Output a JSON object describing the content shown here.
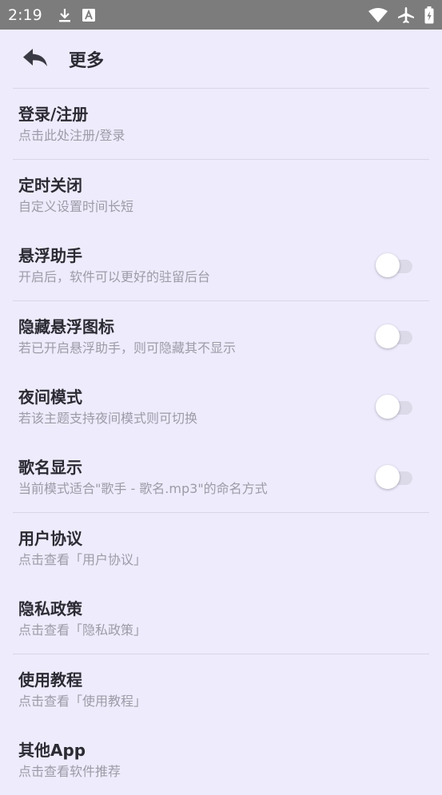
{
  "status_bar": {
    "time": "2:19",
    "icons": [
      "download-icon",
      "a-badge-icon",
      "wifi-icon",
      "airplane-icon",
      "battery-icon"
    ]
  },
  "app_bar": {
    "title": "更多",
    "back_icon": "reply-arrow-icon"
  },
  "colors": {
    "background": "#eeebfc",
    "status_bar": "#7c7c7c",
    "title_text": "#2b2b33",
    "subtitle_text": "#9d9ba8",
    "divider": "#d9d6e6",
    "switch_track_off": "#dcd9e8",
    "switch_thumb": "#ffffff"
  },
  "items": [
    {
      "title": "登录/注册",
      "subtitle": "点击此处注册/登录"
    },
    {
      "title": "定时关闭",
      "subtitle": "自定义设置时间长短"
    },
    {
      "title": "悬浮助手",
      "subtitle": "开启后，软件可以更好的驻留后台",
      "toggle": false
    },
    {
      "title": "隐藏悬浮图标",
      "subtitle": "若已开启悬浮助手，则可隐藏其不显示",
      "toggle": false
    },
    {
      "title": "夜间模式",
      "subtitle": "若该主题支持夜间模式则可切换",
      "toggle": false
    },
    {
      "title": "歌名显示",
      "subtitle": "当前模式适合\"歌手 - 歌名.mp3\"的命名方式",
      "toggle": false
    },
    {
      "title": "用户协议",
      "subtitle": "点击查看「用户协议」"
    },
    {
      "title": "隐私政策",
      "subtitle": "点击查看「隐私政策」"
    },
    {
      "title": "使用教程",
      "subtitle": "点击查看「使用教程」"
    },
    {
      "title": "其他App",
      "subtitle": "点击查看软件推荐"
    }
  ]
}
